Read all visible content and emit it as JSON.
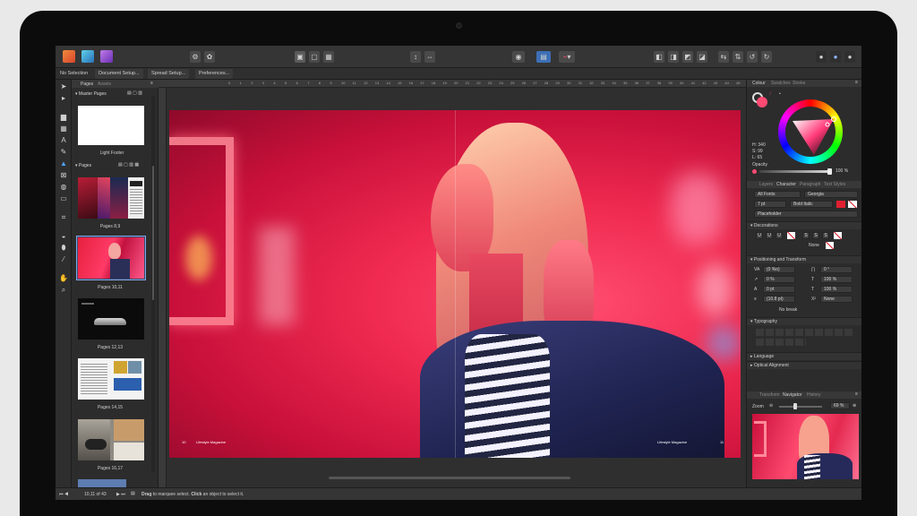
{
  "toolbar": {
    "brand_colors": [
      "#e8653a",
      "#3aa0c8",
      "#8a4fd1"
    ]
  },
  "context_toolbar": {
    "items": [
      "No Selection",
      "Document Setup...",
      "Spread Setup...",
      "Preferences..."
    ]
  },
  "pages_panel": {
    "tabs": [
      "Pages",
      "Assets"
    ],
    "master_pages_label": "Master Pages",
    "master_thumb_label": "Light Footer",
    "pages_label": "Pages",
    "thumbnails": [
      "Pages 8,9",
      "Pages 10,11",
      "Pages 12,13",
      "Pages 14,15",
      "Pages 16,17"
    ]
  },
  "ruler": {
    "ticks": [
      "0",
      "1",
      "2",
      "3",
      "4",
      "5",
      "6",
      "7",
      "8",
      "9",
      "10",
      "11",
      "12",
      "13",
      "14",
      "15",
      "16",
      "17",
      "18",
      "19",
      "20",
      "21",
      "22",
      "23",
      "24",
      "25",
      "26",
      "27",
      "28",
      "29",
      "30",
      "31",
      "32",
      "33",
      "34",
      "35",
      "36",
      "37",
      "38",
      "39",
      "40",
      "41",
      "42",
      "43",
      "44",
      "45",
      "46",
      "47",
      "48"
    ]
  },
  "spread": {
    "footer_left": "Lifestyle Magazine",
    "footer_right": "Lifestyle Magazine",
    "page_left": "10",
    "page_right": "11"
  },
  "colour_panel": {
    "tabs": [
      "Colour",
      "Swatches",
      "Stroke"
    ],
    "h": "H: 340",
    "s": "S: 99",
    "l": "L: 65",
    "opacity_label": "Opacity",
    "opacity_value": "100 %"
  },
  "character_panel": {
    "tabs": [
      "Layers",
      "Character",
      "Paragraph",
      "Text Styles"
    ],
    "font_collection": "All Fonts",
    "font_family": "Georgia",
    "font_size": "7 pt",
    "font_style": "Bold Italic",
    "placeholder": "Placeholder",
    "decorations_label": "Decorations",
    "decoration_buttons": [
      "U",
      "U",
      "U",
      "S",
      "S",
      "S"
    ],
    "none_label": "None",
    "positioning_label": "Positioning and Transform",
    "pos_fields": [
      "(0 %o)",
      "0 %",
      "0 pt",
      "(10.8 pt)"
    ],
    "pos_fields_right": [
      "0 °",
      "100 %",
      "100 %",
      "None"
    ],
    "no_break": "No break",
    "typography_label": "Typography",
    "language_label": "Language",
    "optical_label": "Optical Alignment"
  },
  "navigator_panel": {
    "tabs": [
      "Transform",
      "Navigator",
      "History"
    ],
    "zoom_label": "Zoom",
    "zoom_value": "69 %"
  },
  "status_bar": {
    "page": "10,11 of 43",
    "hint_drag": "Drag",
    "hint_mid": "to marquee select.",
    "hint_click": "Click",
    "hint_end": "an object to select it."
  }
}
